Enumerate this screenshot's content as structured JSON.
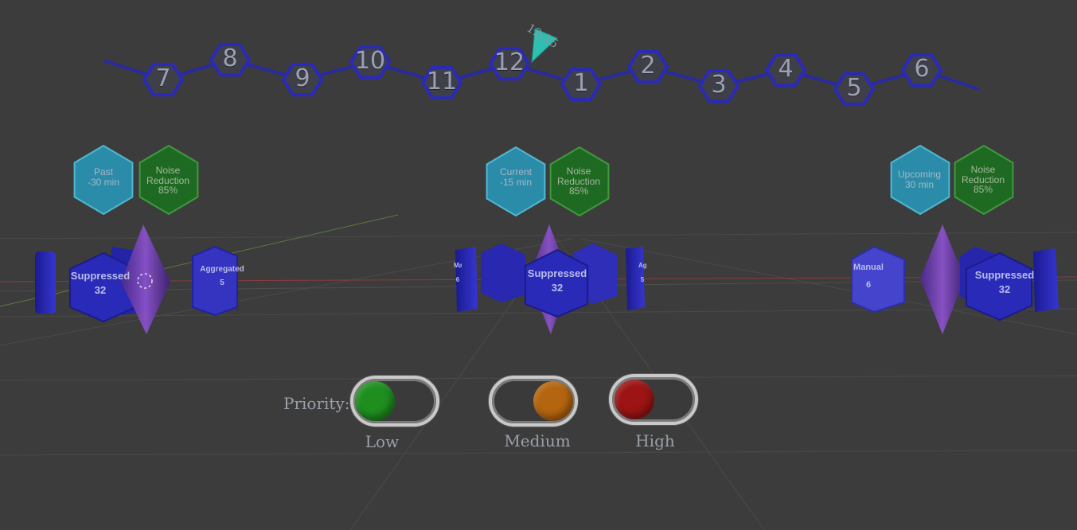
{
  "timeline": {
    "hours": [
      "7",
      "8",
      "9",
      "10",
      "11",
      "12",
      "1",
      "2",
      "3",
      "4",
      "5",
      "6"
    ],
    "current_time": "12:15",
    "pointer_color": "#2fbfb0"
  },
  "panels": [
    {
      "time_chip": {
        "line1": "Past",
        "line2": "-30 min"
      },
      "noise_chip": {
        "line1": "Noise",
        "line2": "Reduction",
        "line3": "85%"
      },
      "suppressed": {
        "label": "Suppressed",
        "count": "32"
      },
      "side_node": {
        "label": "Aggregated",
        "count": "5"
      }
    },
    {
      "time_chip": {
        "line1": "Current",
        "line2": "-15 min"
      },
      "noise_chip": {
        "line1": "Noise",
        "line2": "Reduction",
        "line3": "85%"
      },
      "suppressed": {
        "label": "Suppressed",
        "count": "32"
      },
      "side_left": {
        "label": "Manual",
        "count": "6"
      },
      "side_right": {
        "label": "Aggregated",
        "count": "5"
      }
    },
    {
      "time_chip": {
        "line1": "Upcoming",
        "line2": "30 min"
      },
      "noise_chip": {
        "line1": "Noise",
        "line2": "Reduction",
        "line3": "85%"
      },
      "suppressed": {
        "label": "Suppressed",
        "count": "32"
      },
      "side_node": {
        "label": "Manual",
        "count": "6"
      }
    }
  ],
  "priority": {
    "label": "Priority:",
    "toggles": [
      {
        "label": "Low",
        "color": "#1e8e1e",
        "state": "off"
      },
      {
        "label": "Medium",
        "color": "#b4650f",
        "state": "on"
      },
      {
        "label": "High",
        "color": "#9c1414",
        "state": "off"
      }
    ]
  },
  "colors": {
    "background": "#3c3c3c",
    "node_blue": "#2a2ab8",
    "chip_cyan": "#2a8ca8",
    "chip_green": "#1f6a22",
    "crystal_purple": "#6a3aa8"
  }
}
